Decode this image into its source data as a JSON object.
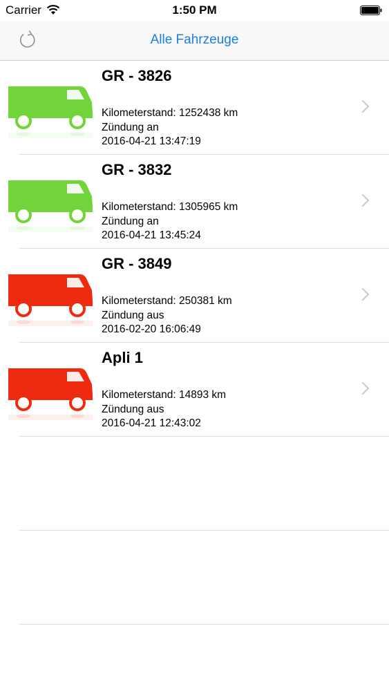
{
  "status_bar": {
    "carrier": "Carrier",
    "time": "1:50 PM"
  },
  "nav": {
    "title": "Alle Fahrzeuge",
    "refresh_icon": "refresh-icon",
    "accent_color": "#1a7fe0"
  },
  "vehicles": [
    {
      "name": "GR - 3826",
      "odometer": "Kilometerstand: 1252438 km",
      "ignition": "Zündung an",
      "timestamp": "2016-04-21 13:47:19",
      "status_color": "#71d43a"
    },
    {
      "name": "GR - 3832",
      "odometer": "Kilometerstand: 1305965 km",
      "ignition": "Zündung an",
      "timestamp": "2016-04-21 13:45:24",
      "status_color": "#71d43a"
    },
    {
      "name": "GR - 3849",
      "odometer": "Kilometerstand: 250381 km",
      "ignition": "Zündung aus",
      "timestamp": "2016-02-20 16:06:49",
      "status_color": "#ee2a10"
    },
    {
      "name": "Apli 1",
      "odometer": "Kilometerstand: 14893 km",
      "ignition": "Zündung aus",
      "timestamp": "2016-04-21 12:43:02",
      "status_color": "#ee2a10"
    }
  ]
}
